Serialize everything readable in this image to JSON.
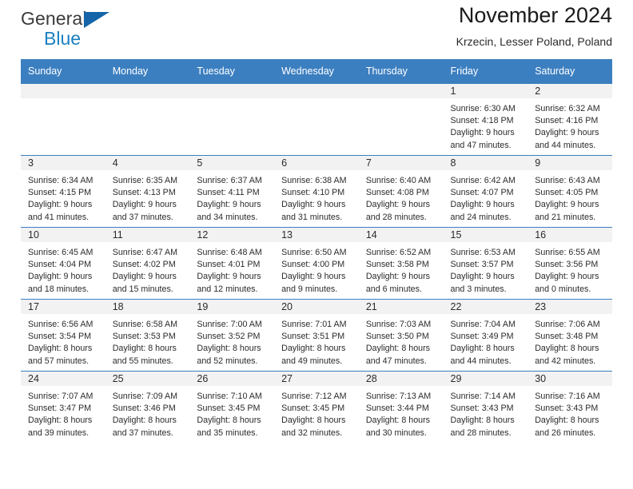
{
  "brand": {
    "name_part1": "General",
    "name_part2": "Blue",
    "triangle_icon": "brand-triangle-icon",
    "accent_color": "#1a7fc1",
    "triangle_color": "#1565a8"
  },
  "header": {
    "title": "November 2024",
    "subtitle": "Krzecin, Lesser Poland, Poland"
  },
  "calendar": {
    "header_bg": "#3c7fc0",
    "header_text_color": "#ffffff",
    "daynum_bg": "#f2f2f2",
    "weekday_headers": [
      "Sunday",
      "Monday",
      "Tuesday",
      "Wednesday",
      "Thursday",
      "Friday",
      "Saturday"
    ],
    "labels": {
      "sunrise": "Sunrise:",
      "sunset": "Sunset:",
      "daylight": "Daylight:"
    },
    "weeks": [
      [
        {
          "day": "",
          "sunrise": "",
          "sunset": "",
          "daylight_a": "",
          "daylight_b": ""
        },
        {
          "day": "",
          "sunrise": "",
          "sunset": "",
          "daylight_a": "",
          "daylight_b": ""
        },
        {
          "day": "",
          "sunrise": "",
          "sunset": "",
          "daylight_a": "",
          "daylight_b": ""
        },
        {
          "day": "",
          "sunrise": "",
          "sunset": "",
          "daylight_a": "",
          "daylight_b": ""
        },
        {
          "day": "",
          "sunrise": "",
          "sunset": "",
          "daylight_a": "",
          "daylight_b": ""
        },
        {
          "day": "1",
          "sunrise": "Sunrise: 6:30 AM",
          "sunset": "Sunset: 4:18 PM",
          "daylight_a": "Daylight: 9 hours",
          "daylight_b": "and 47 minutes."
        },
        {
          "day": "2",
          "sunrise": "Sunrise: 6:32 AM",
          "sunset": "Sunset: 4:16 PM",
          "daylight_a": "Daylight: 9 hours",
          "daylight_b": "and 44 minutes."
        }
      ],
      [
        {
          "day": "3",
          "sunrise": "Sunrise: 6:34 AM",
          "sunset": "Sunset: 4:15 PM",
          "daylight_a": "Daylight: 9 hours",
          "daylight_b": "and 41 minutes."
        },
        {
          "day": "4",
          "sunrise": "Sunrise: 6:35 AM",
          "sunset": "Sunset: 4:13 PM",
          "daylight_a": "Daylight: 9 hours",
          "daylight_b": "and 37 minutes."
        },
        {
          "day": "5",
          "sunrise": "Sunrise: 6:37 AM",
          "sunset": "Sunset: 4:11 PM",
          "daylight_a": "Daylight: 9 hours",
          "daylight_b": "and 34 minutes."
        },
        {
          "day": "6",
          "sunrise": "Sunrise: 6:38 AM",
          "sunset": "Sunset: 4:10 PM",
          "daylight_a": "Daylight: 9 hours",
          "daylight_b": "and 31 minutes."
        },
        {
          "day": "7",
          "sunrise": "Sunrise: 6:40 AM",
          "sunset": "Sunset: 4:08 PM",
          "daylight_a": "Daylight: 9 hours",
          "daylight_b": "and 28 minutes."
        },
        {
          "day": "8",
          "sunrise": "Sunrise: 6:42 AM",
          "sunset": "Sunset: 4:07 PM",
          "daylight_a": "Daylight: 9 hours",
          "daylight_b": "and 24 minutes."
        },
        {
          "day": "9",
          "sunrise": "Sunrise: 6:43 AM",
          "sunset": "Sunset: 4:05 PM",
          "daylight_a": "Daylight: 9 hours",
          "daylight_b": "and 21 minutes."
        }
      ],
      [
        {
          "day": "10",
          "sunrise": "Sunrise: 6:45 AM",
          "sunset": "Sunset: 4:04 PM",
          "daylight_a": "Daylight: 9 hours",
          "daylight_b": "and 18 minutes."
        },
        {
          "day": "11",
          "sunrise": "Sunrise: 6:47 AM",
          "sunset": "Sunset: 4:02 PM",
          "daylight_a": "Daylight: 9 hours",
          "daylight_b": "and 15 minutes."
        },
        {
          "day": "12",
          "sunrise": "Sunrise: 6:48 AM",
          "sunset": "Sunset: 4:01 PM",
          "daylight_a": "Daylight: 9 hours",
          "daylight_b": "and 12 minutes."
        },
        {
          "day": "13",
          "sunrise": "Sunrise: 6:50 AM",
          "sunset": "Sunset: 4:00 PM",
          "daylight_a": "Daylight: 9 hours",
          "daylight_b": "and 9 minutes."
        },
        {
          "day": "14",
          "sunrise": "Sunrise: 6:52 AM",
          "sunset": "Sunset: 3:58 PM",
          "daylight_a": "Daylight: 9 hours",
          "daylight_b": "and 6 minutes."
        },
        {
          "day": "15",
          "sunrise": "Sunrise: 6:53 AM",
          "sunset": "Sunset: 3:57 PM",
          "daylight_a": "Daylight: 9 hours",
          "daylight_b": "and 3 minutes."
        },
        {
          "day": "16",
          "sunrise": "Sunrise: 6:55 AM",
          "sunset": "Sunset: 3:56 PM",
          "daylight_a": "Daylight: 9 hours",
          "daylight_b": "and 0 minutes."
        }
      ],
      [
        {
          "day": "17",
          "sunrise": "Sunrise: 6:56 AM",
          "sunset": "Sunset: 3:54 PM",
          "daylight_a": "Daylight: 8 hours",
          "daylight_b": "and 57 minutes."
        },
        {
          "day": "18",
          "sunrise": "Sunrise: 6:58 AM",
          "sunset": "Sunset: 3:53 PM",
          "daylight_a": "Daylight: 8 hours",
          "daylight_b": "and 55 minutes."
        },
        {
          "day": "19",
          "sunrise": "Sunrise: 7:00 AM",
          "sunset": "Sunset: 3:52 PM",
          "daylight_a": "Daylight: 8 hours",
          "daylight_b": "and 52 minutes."
        },
        {
          "day": "20",
          "sunrise": "Sunrise: 7:01 AM",
          "sunset": "Sunset: 3:51 PM",
          "daylight_a": "Daylight: 8 hours",
          "daylight_b": "and 49 minutes."
        },
        {
          "day": "21",
          "sunrise": "Sunrise: 7:03 AM",
          "sunset": "Sunset: 3:50 PM",
          "daylight_a": "Daylight: 8 hours",
          "daylight_b": "and 47 minutes."
        },
        {
          "day": "22",
          "sunrise": "Sunrise: 7:04 AM",
          "sunset": "Sunset: 3:49 PM",
          "daylight_a": "Daylight: 8 hours",
          "daylight_b": "and 44 minutes."
        },
        {
          "day": "23",
          "sunrise": "Sunrise: 7:06 AM",
          "sunset": "Sunset: 3:48 PM",
          "daylight_a": "Daylight: 8 hours",
          "daylight_b": "and 42 minutes."
        }
      ],
      [
        {
          "day": "24",
          "sunrise": "Sunrise: 7:07 AM",
          "sunset": "Sunset: 3:47 PM",
          "daylight_a": "Daylight: 8 hours",
          "daylight_b": "and 39 minutes."
        },
        {
          "day": "25",
          "sunrise": "Sunrise: 7:09 AM",
          "sunset": "Sunset: 3:46 PM",
          "daylight_a": "Daylight: 8 hours",
          "daylight_b": "and 37 minutes."
        },
        {
          "day": "26",
          "sunrise": "Sunrise: 7:10 AM",
          "sunset": "Sunset: 3:45 PM",
          "daylight_a": "Daylight: 8 hours",
          "daylight_b": "and 35 minutes."
        },
        {
          "day": "27",
          "sunrise": "Sunrise: 7:12 AM",
          "sunset": "Sunset: 3:45 PM",
          "daylight_a": "Daylight: 8 hours",
          "daylight_b": "and 32 minutes."
        },
        {
          "day": "28",
          "sunrise": "Sunrise: 7:13 AM",
          "sunset": "Sunset: 3:44 PM",
          "daylight_a": "Daylight: 8 hours",
          "daylight_b": "and 30 minutes."
        },
        {
          "day": "29",
          "sunrise": "Sunrise: 7:14 AM",
          "sunset": "Sunset: 3:43 PM",
          "daylight_a": "Daylight: 8 hours",
          "daylight_b": "and 28 minutes."
        },
        {
          "day": "30",
          "sunrise": "Sunrise: 7:16 AM",
          "sunset": "Sunset: 3:43 PM",
          "daylight_a": "Daylight: 8 hours",
          "daylight_b": "and 26 minutes."
        }
      ]
    ]
  }
}
